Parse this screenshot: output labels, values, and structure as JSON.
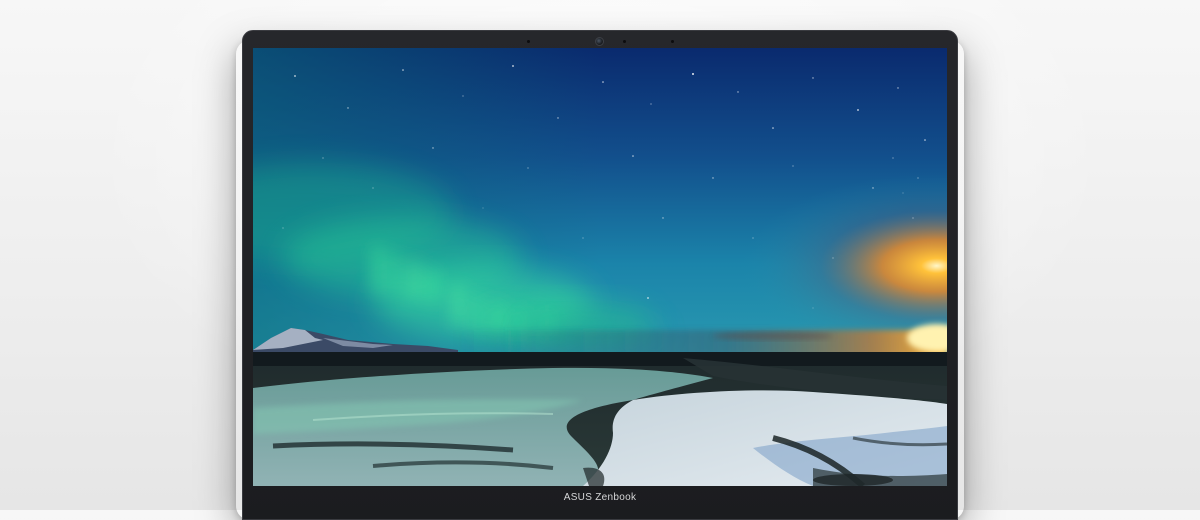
{
  "device": {
    "brand_label": "ASUS Zenbook",
    "wallpaper": "aurora-over-river-landscape"
  },
  "colors": {
    "bezel": "#1b1c1f",
    "sky_top": "#0a2a6e",
    "sky_mid": "#1a78a8",
    "aurora": "#3cf0a0",
    "sunset": "#ffb020",
    "background": "#eeeeee"
  }
}
